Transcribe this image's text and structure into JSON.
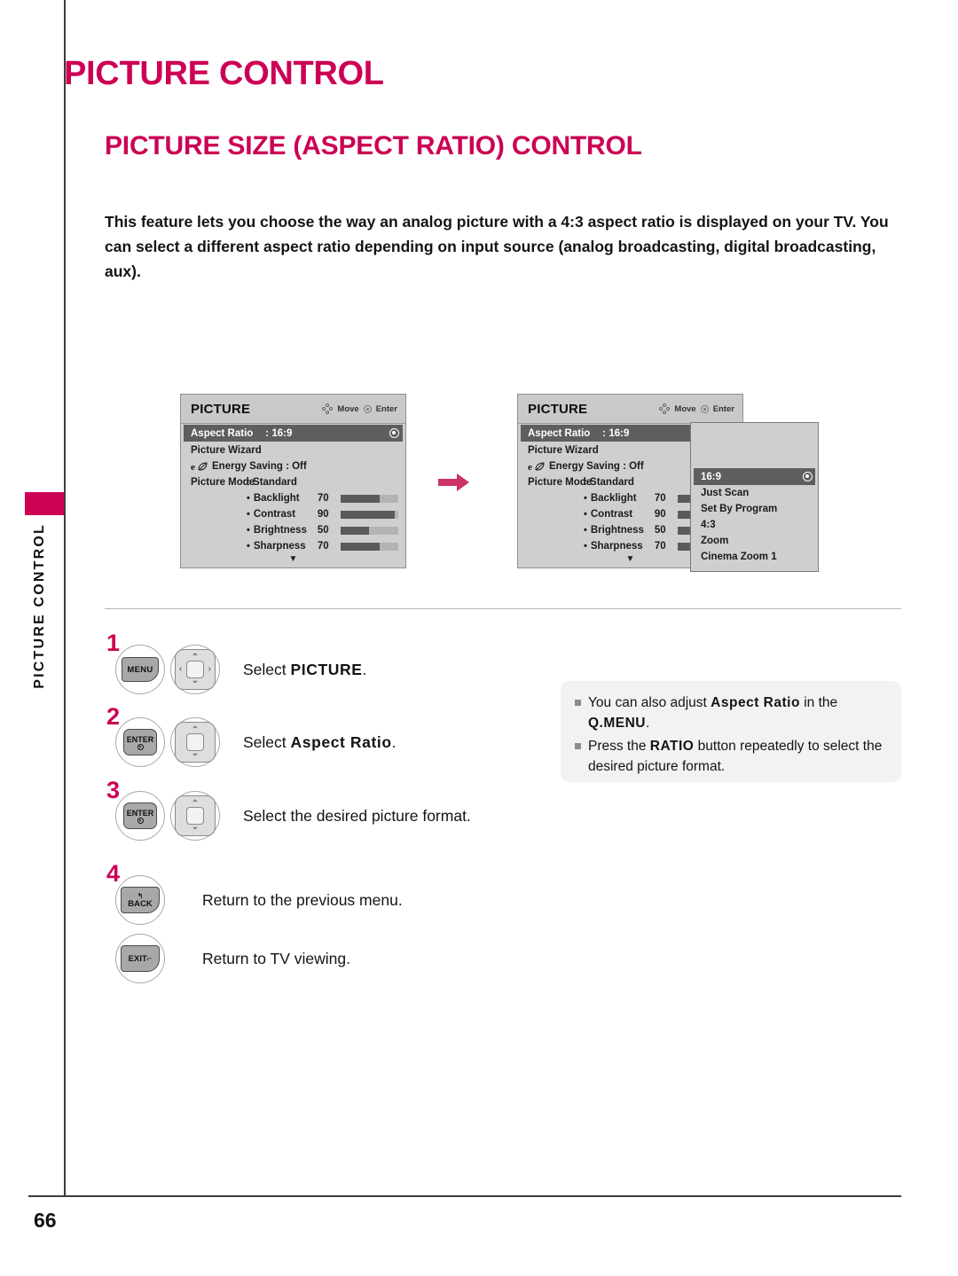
{
  "sidebar": {
    "vertical_label": "PICTURE CONTROL"
  },
  "titles": {
    "page_title": "PICTURE CONTROL",
    "section_title": "PICTURE SIZE (ASPECT RATIO) CONTROL"
  },
  "intro": "This feature lets you choose the way an analog picture with a 4:3 aspect ratio is displayed on your TV. You can select a different aspect ratio depending on input source (analog broadcasting, digital broadcasting, aux).",
  "osd": {
    "title": "PICTURE",
    "hint_move": "Move",
    "hint_enter": "Enter",
    "rows": {
      "aspect_ratio_label": "Aspect Ratio",
      "aspect_ratio_value": ": 16:9",
      "picture_wizard": "Picture Wizard",
      "energy_saving": "Energy Saving : Off",
      "picture_mode_label": "Picture Mode",
      "picture_mode_value": ": Standard"
    },
    "sliders": [
      {
        "label": "Backlight",
        "value": "70",
        "percent": 68
      },
      {
        "label": "Contrast",
        "value": "90",
        "percent": 94
      },
      {
        "label": "Brightness",
        "value": "50",
        "percent": 50
      },
      {
        "label": "Sharpness",
        "value": "70",
        "percent": 68
      }
    ],
    "scroll_down_glyph": "▼"
  },
  "dropdown": {
    "options": [
      "16:9",
      "Just Scan",
      "Set By Program",
      "4:3",
      "Zoom",
      "Cinema Zoom 1"
    ],
    "selected": "16:9"
  },
  "steps": [
    {
      "number": "1",
      "key": "MENU",
      "text_prefix": "Select ",
      "text_bold": "PICTURE",
      "text_suffix": "."
    },
    {
      "number": "2",
      "key": "ENTER",
      "text_prefix": "Select ",
      "text_bold": "Aspect Ratio",
      "text_suffix": "."
    },
    {
      "number": "3",
      "key": "ENTER",
      "text_prefix": "Select the desired picture format.",
      "text_bold": "",
      "text_suffix": ""
    },
    {
      "number": "4",
      "key": "BACK",
      "text_prefix": "Return to the previous menu.",
      "text_bold": "",
      "text_suffix": ""
    },
    {
      "number": "",
      "key": "EXIT",
      "text_prefix": "Return to TV viewing.",
      "text_bold": "",
      "text_suffix": ""
    }
  ],
  "note": {
    "items": [
      {
        "part1": "You can also adjust ",
        "bold1": "Aspect Ratio",
        "part2": " in the ",
        "bold2": "Q.MENU",
        "part3": "."
      },
      {
        "part1": "Press the ",
        "bold1": "RATIO",
        "part2": " button repeatedly to select the desired picture format.",
        "bold2": "",
        "part3": ""
      }
    ]
  },
  "page_number": "66",
  "colors": {
    "brand_magenta": "#cc0055",
    "osd_panel": "#cfcfcf",
    "osd_selected": "#5e5e5e",
    "note_bg": "#f2f2f2"
  }
}
